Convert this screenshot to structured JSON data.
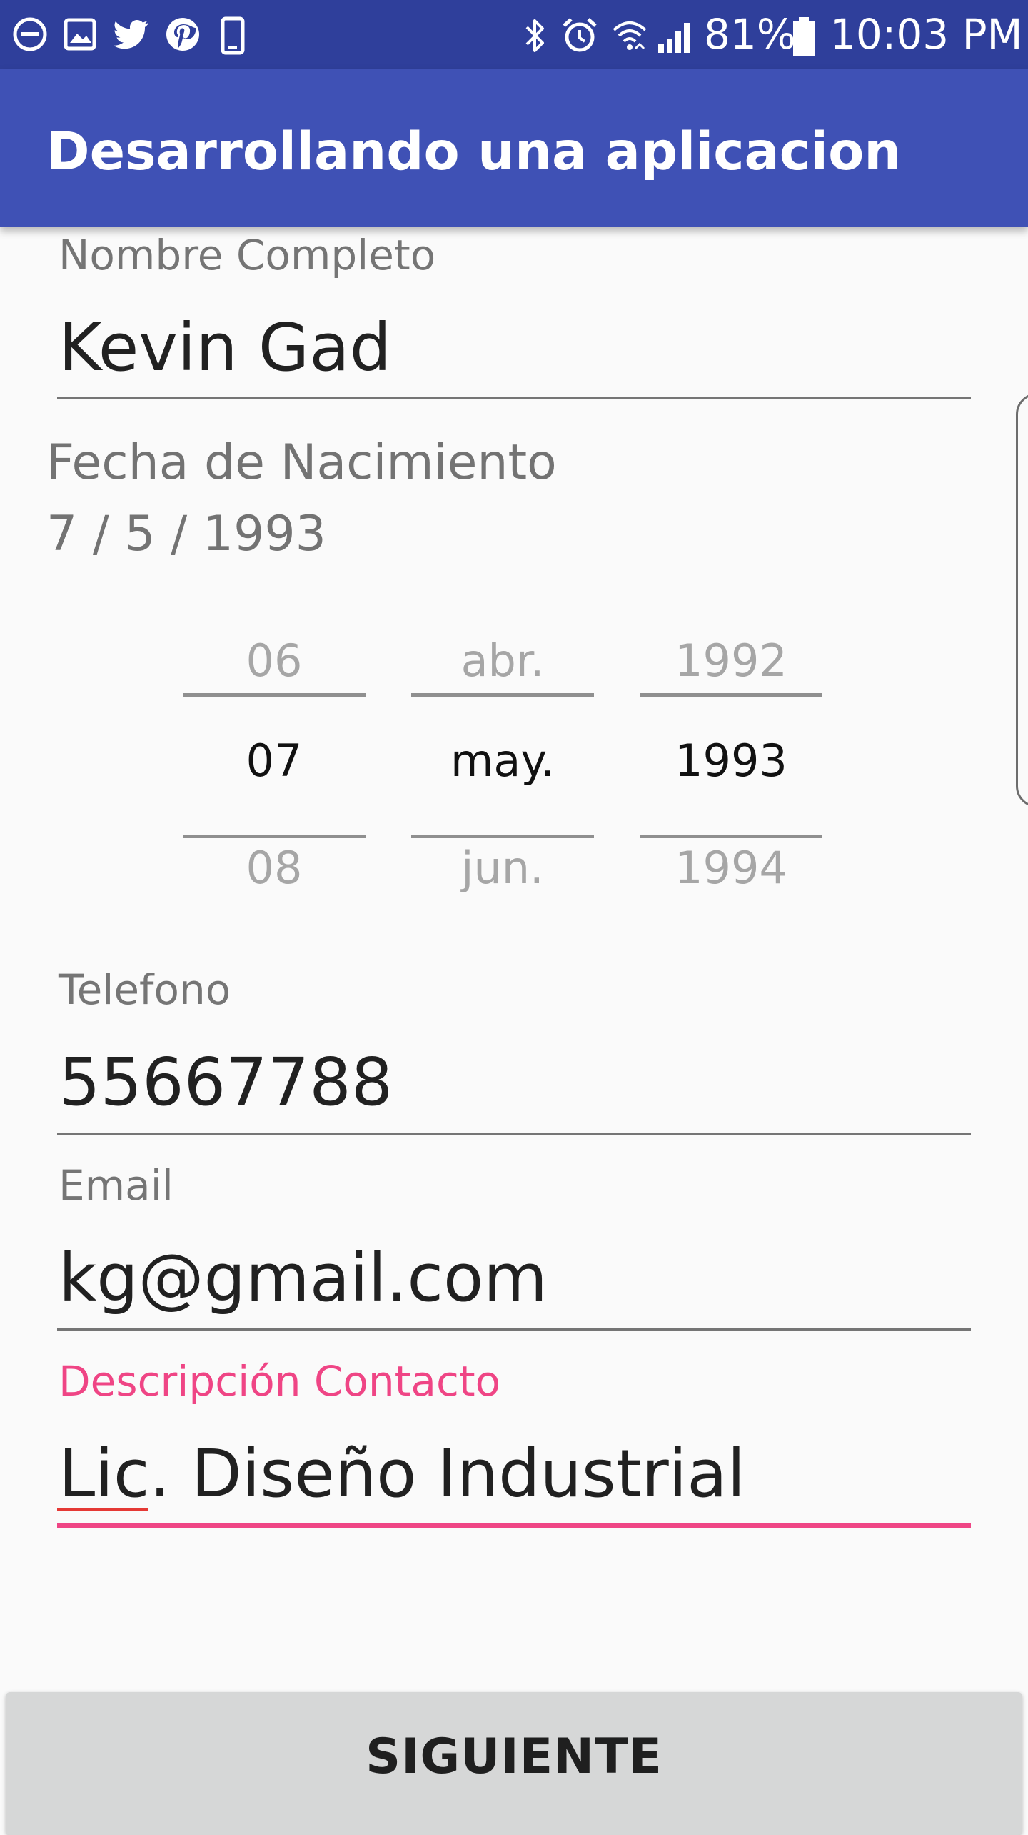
{
  "status_bar": {
    "icons": [
      "do-not-disturb-icon",
      "image-icon",
      "twitter-icon",
      "pinterest-icon",
      "phone-vibrate-icon",
      "bluetooth-icon",
      "alarm-icon",
      "wifi-icon",
      "cell-signal-icon",
      "battery-icon"
    ],
    "battery_percent": "81%",
    "time": "10:03 PM"
  },
  "app_bar": {
    "title": "Desarrollando una aplicacion"
  },
  "form": {
    "name": {
      "label": "Nombre Completo",
      "value": "Kevin Gad"
    },
    "birth_date": {
      "label": "Fecha de Nacimiento",
      "value": "7 / 5 / 1993"
    },
    "date_picker": {
      "day": {
        "prev": "06",
        "selected": "07",
        "next": "08"
      },
      "month": {
        "prev": "abr.",
        "selected": "may.",
        "next": "jun."
      },
      "year": {
        "prev": "1992",
        "selected": "1993",
        "next": "1994"
      }
    },
    "phone": {
      "label": "Telefono",
      "value": "55667788"
    },
    "email": {
      "label": "Email",
      "value": "kg@gmail.com"
    },
    "description": {
      "label": "Descripción Contacto",
      "value": "Lic. Diseño Industrial"
    }
  },
  "actions": {
    "next_label": "SIGUIENTE"
  },
  "colors": {
    "status_bar": "#2f3f9b",
    "app_bar": "#3f51b5",
    "accent": "#ef4585",
    "background": "#fafafa",
    "button": "#d6d7d7"
  }
}
